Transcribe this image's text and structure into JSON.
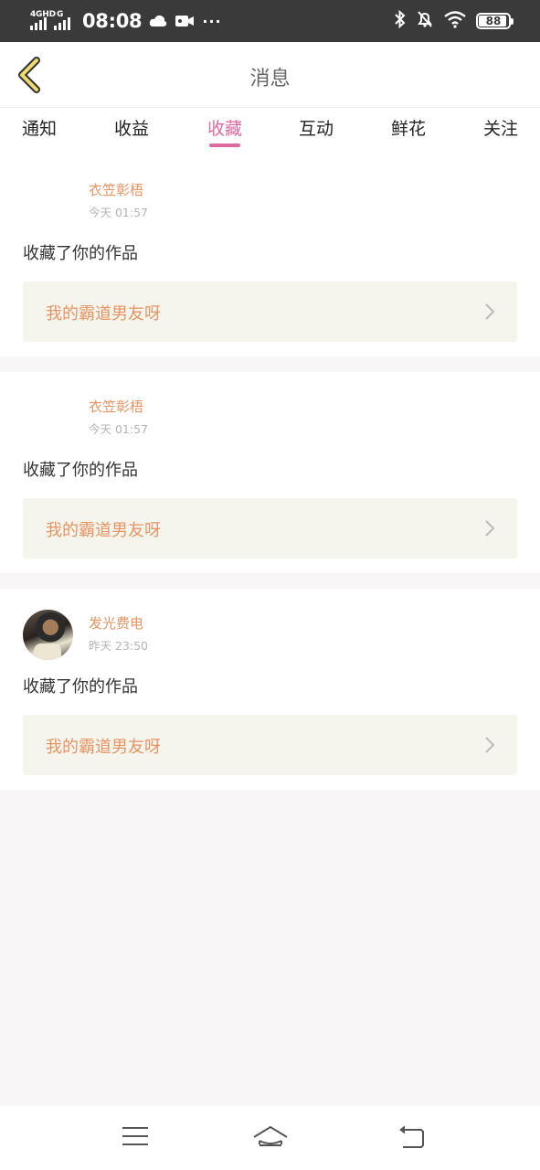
{
  "status_bar": {
    "network_1": "4GHD",
    "network_2": "G",
    "time": "08:08",
    "battery": "88",
    "icons": [
      "cloud-icon",
      "video-icon",
      "more-dots-icon",
      "bluetooth-icon",
      "bell-off-icon",
      "wifi-icon",
      "battery-icon"
    ]
  },
  "header": {
    "title": "消息",
    "back_icon": "back-chevron-icon"
  },
  "tabs": [
    {
      "label": "通知",
      "active": false
    },
    {
      "label": "收益",
      "active": false
    },
    {
      "label": "收藏",
      "active": true
    },
    {
      "label": "互动",
      "active": false
    },
    {
      "label": "鲜花",
      "active": false
    },
    {
      "label": "关注",
      "active": false
    }
  ],
  "messages": [
    {
      "user": "衣笠彰梧",
      "time": "今天 01:57",
      "action": "收藏了你的作品",
      "work_title": "我的霸道男友呀",
      "has_avatar": false
    },
    {
      "user": "衣笠彰梧",
      "time": "今天 01:57",
      "action": "收藏了你的作品",
      "work_title": "我的霸道男友呀",
      "has_avatar": false
    },
    {
      "user": "发光费电",
      "time": "昨天 23:50",
      "action": "收藏了你的作品",
      "work_title": "我的霸道男友呀",
      "has_avatar": true
    }
  ],
  "nav_bar": {
    "icons": [
      "menu-icon",
      "home-icon",
      "back-icon"
    ]
  },
  "colors": {
    "accent": "#de6aa1",
    "name": "#e59462",
    "status_bar": "#3a3a3a",
    "work_bg": "#f5f5ee"
  }
}
